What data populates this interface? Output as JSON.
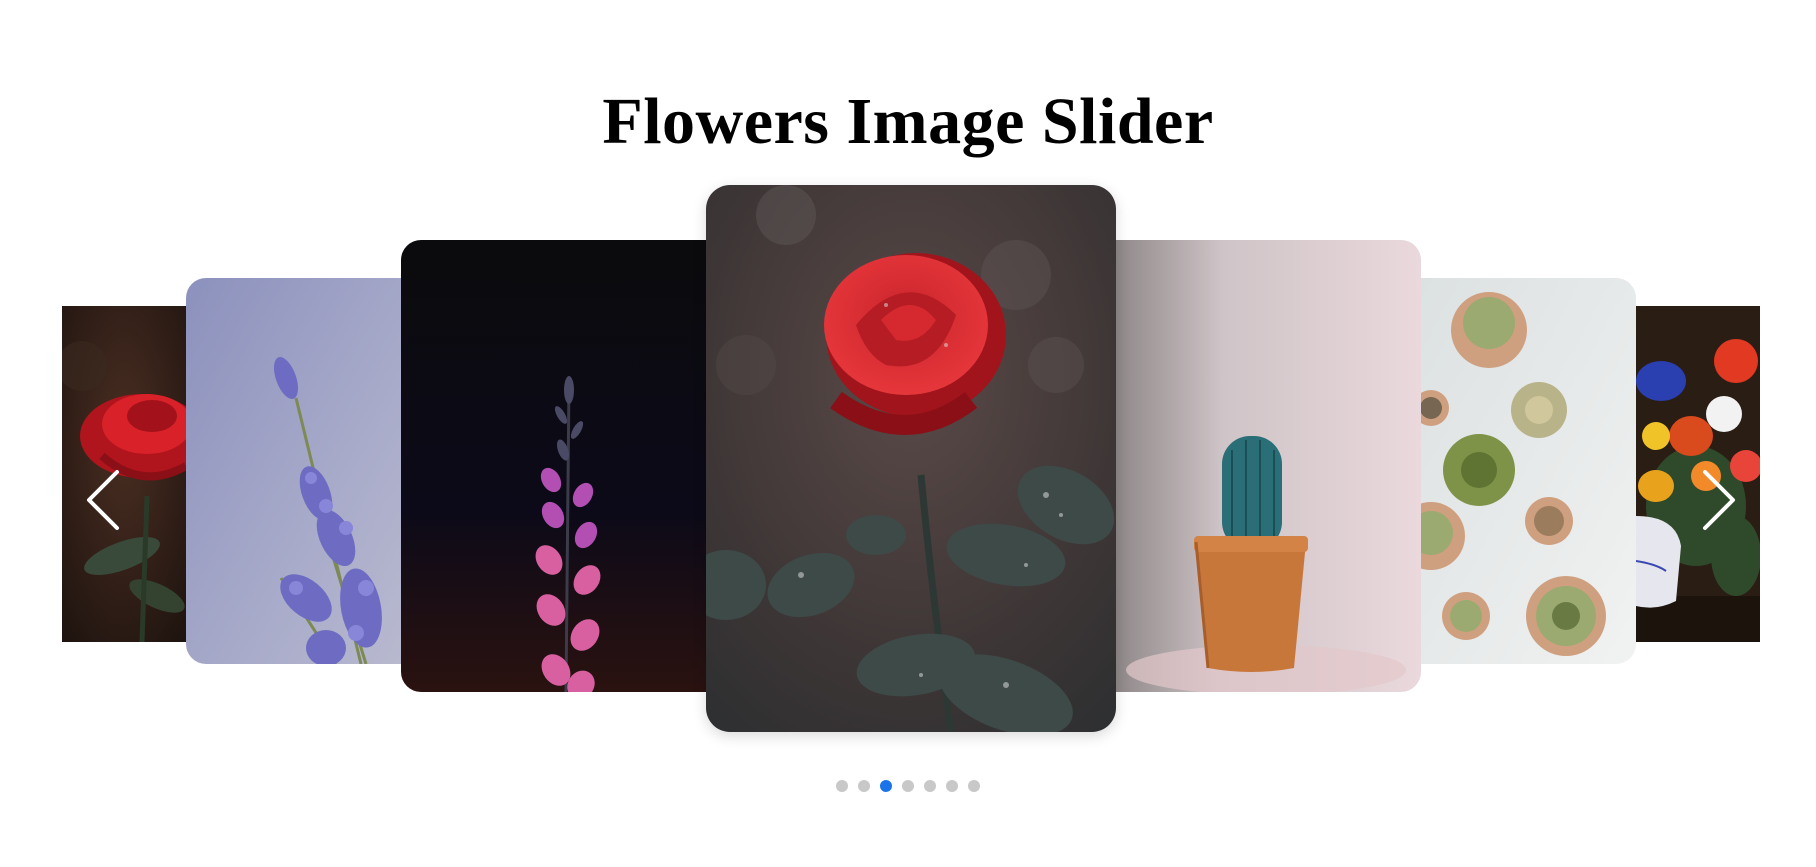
{
  "page": {
    "title": "Flowers Image Slider"
  },
  "slider": {
    "slides": [
      {
        "name": "red-rose-dark"
      },
      {
        "name": "lavender"
      },
      {
        "name": "pink-foxglove"
      },
      {
        "name": "red-rose-dewdrops"
      },
      {
        "name": "cactus-pot"
      },
      {
        "name": "succulents-topview"
      },
      {
        "name": "flower-bouquet-vase"
      }
    ],
    "prev_icon": "chevron-left-icon",
    "next_icon": "chevron-right-icon",
    "dots": {
      "count": 7,
      "active_index": 2
    },
    "colors": {
      "dot_active": "#1a73e8",
      "dot_inactive": "#c8c8c8"
    }
  }
}
